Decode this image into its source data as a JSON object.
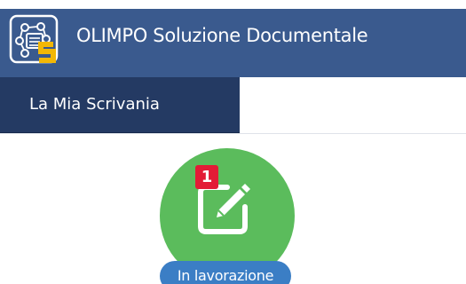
{
  "header": {
    "title": "OLIMPO Soluzione Documentale",
    "logo_icon": "olimpo-logo-icon",
    "background_color": "#3a5a8e"
  },
  "nav": {
    "active_tab_label": "La Mia Scrivania",
    "active_tab_color": "#243a63"
  },
  "tiles": [
    {
      "icon": "edit-icon",
      "badge_count": "1",
      "label": "In lavorazione",
      "circle_color": "#5bbc5c",
      "badge_color": "#e31b36",
      "label_color": "#3b7ec5"
    }
  ]
}
